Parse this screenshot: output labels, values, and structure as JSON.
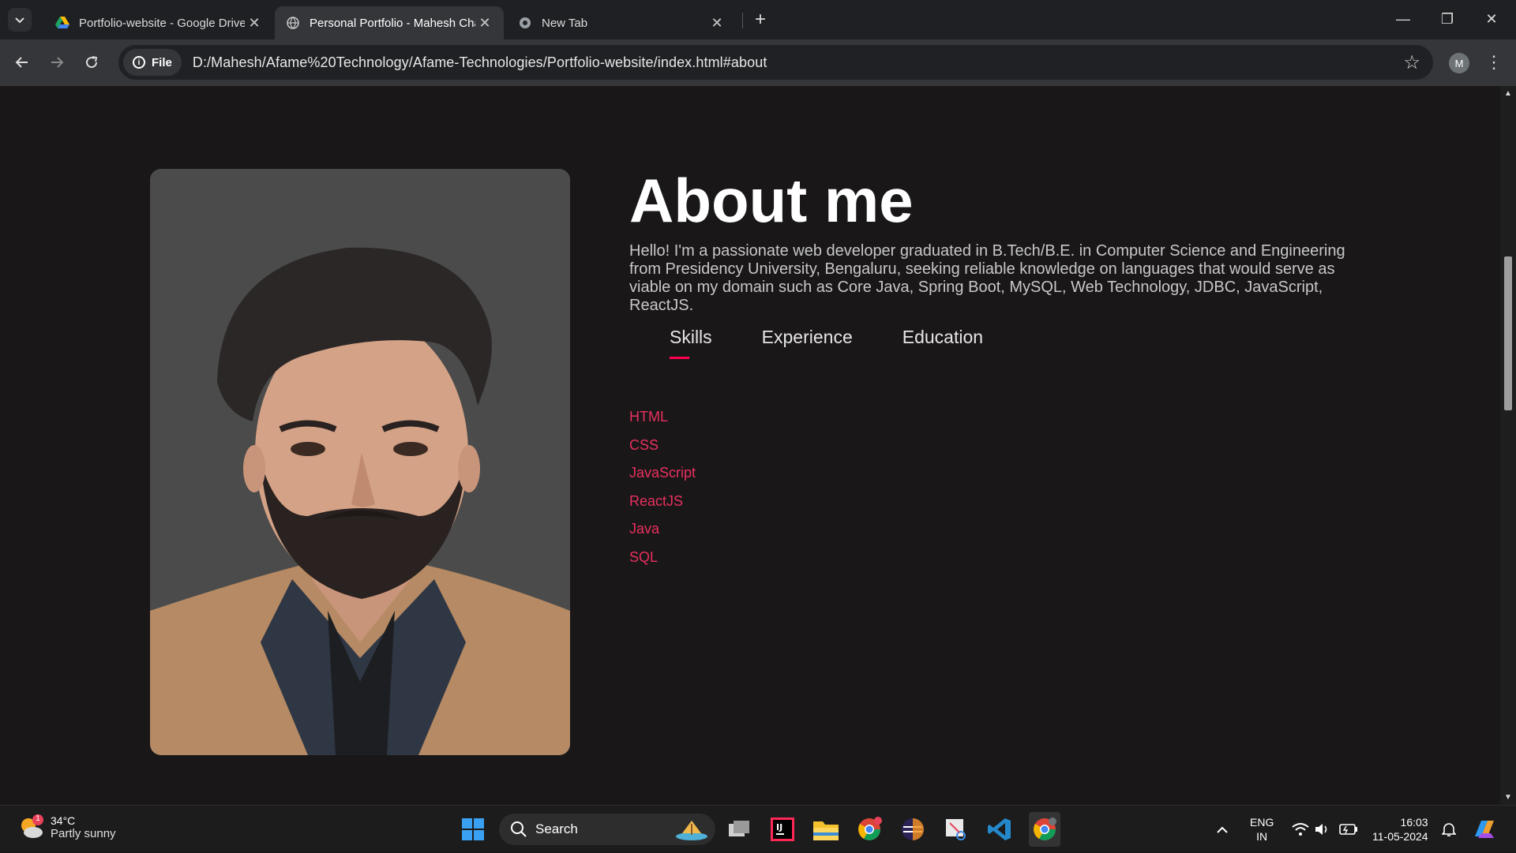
{
  "browser": {
    "tabs": [
      {
        "title": "Portfolio-website - Google Drive",
        "icon": "google-drive-icon"
      },
      {
        "title": "Personal Portfolio - Mahesh Chandra",
        "icon": "globe-icon"
      },
      {
        "title": "New Tab",
        "icon": "chrome-icon"
      }
    ],
    "chip_label": "File",
    "url": "D:/Mahesh/Afame%20Technology/Afame-Technologies/Portfolio-website/index.html#about",
    "profile_initial": "M"
  },
  "page": {
    "heading": "About me",
    "intro": "Hello! I'm a passionate web developer graduated in B.Tech/B.E. in Computer Science and Engineering from Presidency University, Bengaluru, seeking reliable knowledge on languages that would serve as viable on my domain such as Core Java, Spring Boot, MySQL, Web Technology, JDBC, JavaScript, ReactJS.",
    "tabs": [
      "Skills",
      "Experience",
      "Education"
    ],
    "skills": [
      "HTML",
      "CSS",
      "JavaScript",
      "ReactJS",
      "Java",
      "SQL"
    ],
    "accent": "#ff004f"
  },
  "taskbar": {
    "weather_badge": "1",
    "temperature": "34°C",
    "condition": "Partly sunny",
    "search_label": "Search",
    "lang": "ENG",
    "region": "IN",
    "time": "16:03",
    "date": "11-05-2024"
  }
}
